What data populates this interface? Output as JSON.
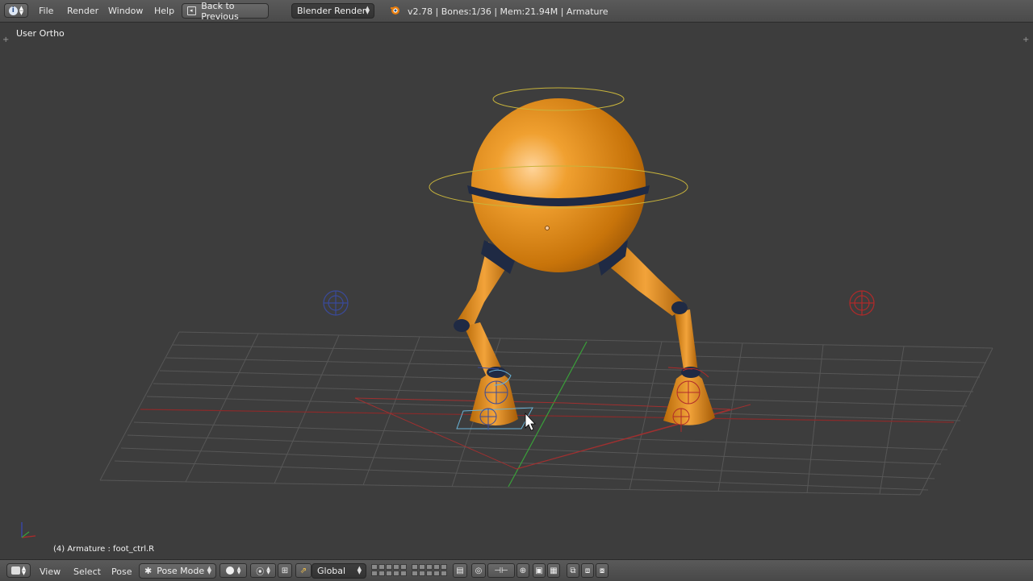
{
  "topbar": {
    "editor_icon": "info-icon",
    "menus": [
      "File",
      "Render",
      "Window",
      "Help"
    ],
    "back_button": "Back to Previous",
    "render_engine": "Blender Render",
    "blender_logo": "blender-logo-icon",
    "status": "v2.78 | Bones:1/36 | Mem:21.94M | Armature"
  },
  "viewport": {
    "view_label": "User Ortho",
    "object_info": "(4) Armature : foot_ctrl.R",
    "colors": {
      "body": "#d98410",
      "band": "#1f2a44",
      "grid": "#575757",
      "x_axis": "#9a2a2a",
      "y_axis": "#3aa03a",
      "bone_circle": "#c8b43c"
    }
  },
  "bottombar": {
    "editor_icon": "3d-view-icon",
    "menus": [
      "View",
      "Select",
      "Pose"
    ],
    "mode": "Pose Mode",
    "orientation": "Global"
  }
}
